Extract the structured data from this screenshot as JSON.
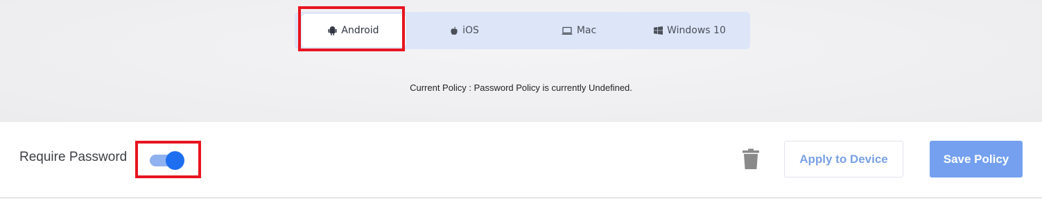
{
  "platform_tabs": [
    {
      "label": "Android",
      "icon": "android-icon",
      "active": true
    },
    {
      "label": "iOS",
      "icon": "apple-icon",
      "active": false
    },
    {
      "label": "Mac",
      "icon": "laptop-icon",
      "active": false
    },
    {
      "label": "Windows 10",
      "icon": "windows-icon",
      "active": false
    }
  ],
  "current_policy_text": "Current Policy : Password Policy is currently Undefined.",
  "settings": {
    "require_password_label": "Require Password",
    "require_password_enabled": true
  },
  "actions": {
    "apply_label": "Apply to Device",
    "save_label": "Save Policy"
  },
  "colors": {
    "accent": "#1e6ff0",
    "highlight": "#e8141f",
    "save_button": "#74a0ef"
  }
}
